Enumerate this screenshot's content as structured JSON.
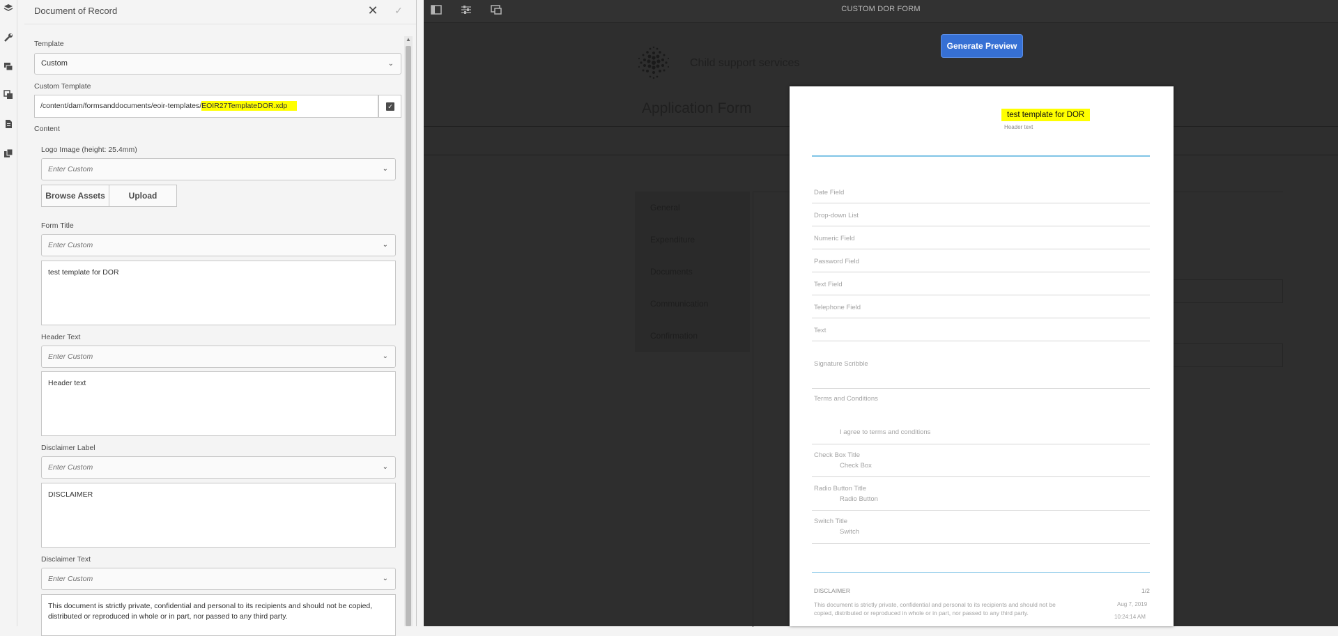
{
  "rail": {
    "icons": [
      "layers-icon",
      "wrench-icon",
      "assets-icon",
      "components-icon",
      "document-icon",
      "content-tree-icon"
    ]
  },
  "panel": {
    "title": "Document of Record",
    "template_label": "Template",
    "template_value": "Custom",
    "custom_template_label": "Custom Template",
    "custom_template_path_prefix": "/content/dam/formsanddocuments/eoir-templates/",
    "custom_template_path_file": "EOIR27TemplateDOR.xdp",
    "content_label": "Content",
    "logo_label": "Logo Image (height: 25.4mm)",
    "logo_placeholder": "Enter Custom",
    "browse_label": "Browse Assets",
    "upload_label": "Upload",
    "form_title_label": "Form Title",
    "form_title_placeholder": "Enter Custom",
    "form_title_value": "test template for DOR",
    "header_text_label": "Header Text",
    "header_text_placeholder": "Enter Custom",
    "header_text_value": "Header text",
    "disclaimer_label_label": "Disclaimer Label",
    "disclaimer_label_placeholder": "Enter Custom",
    "disclaimer_label_value": "DISCLAIMER",
    "disclaimer_text_label": "Disclaimer Text",
    "disclaimer_text_placeholder": "Enter Custom",
    "disclaimer_text_value": "This document is strictly private, confidential and personal to its recipients and should not be copied, distributed or reproduced in whole or in part, nor passed to any third party."
  },
  "canvas": {
    "title": "CUSTOM DOR FORM",
    "brand": "Child support services",
    "app_title": "Application Form",
    "preview_button": "Generate Preview",
    "nav": [
      "General",
      "Expenditure",
      "Documents",
      "Communication",
      "Confirmation"
    ]
  },
  "preview": {
    "title": "test template for DOR",
    "header": "Header text",
    "fields": [
      {
        "label": "Date Field"
      },
      {
        "label": "Drop-down List"
      },
      {
        "label": "Numeric Field"
      },
      {
        "label": "Password Field"
      },
      {
        "label": "Text Field"
      },
      {
        "label": "Telephone Field"
      },
      {
        "label": "Text"
      },
      {
        "label": "Signature Scribble"
      },
      {
        "label": "Terms and Conditions",
        "sub": "I agree to terms and conditions"
      },
      {
        "label": "Check Box Title",
        "sub": "Check Box"
      },
      {
        "label": "Radio Button Title",
        "sub": "Radio Button"
      },
      {
        "label": "Switch Title",
        "sub": "Switch"
      }
    ],
    "disclaimer_label": "DISCLAIMER",
    "page": "1/2",
    "disclaimer_text": "This document is strictly private, confidential and personal to its recipients and should not be copied, distributed or reproduced in whole or in part, nor passed to any third party.",
    "date": "Aug 7, 2019",
    "time": "10:24:14 AM"
  },
  "colors": {
    "highlight": "#ffff00",
    "accent_button": "#3670d4",
    "preview_rule": "#7fc4e6"
  }
}
